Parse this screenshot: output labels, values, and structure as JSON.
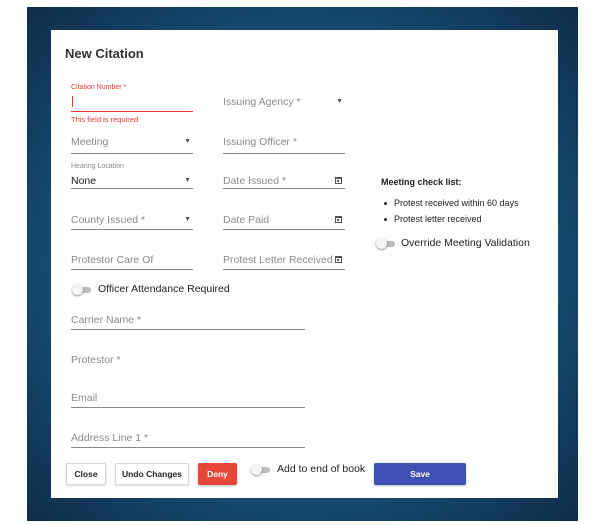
{
  "dialog": {
    "title": "New Citation"
  },
  "form": {
    "citation_number": {
      "label": "Citation Number *",
      "value": "",
      "error": "This field is required"
    },
    "issuing_agency": {
      "placeholder": "Issuing Agency *"
    },
    "meeting": {
      "placeholder": "Meeting"
    },
    "issuing_officer": {
      "placeholder": "Issuing Officer *"
    },
    "hearing_location": {
      "label": "Hearing Location",
      "value": "None"
    },
    "date_issued": {
      "placeholder": "Date Issued *"
    },
    "county_issued": {
      "placeholder": "County Issued *"
    },
    "date_paid": {
      "placeholder": "Date Paid"
    },
    "protestor_care_of": {
      "placeholder": "Protestor Care Of"
    },
    "protest_letter_received": {
      "placeholder": "Protest Letter Received"
    },
    "officer_attendance": {
      "label": "Officer Attendance Required",
      "checked": false
    },
    "carrier_name": {
      "placeholder": "Carrier Name *"
    },
    "protestor": {
      "placeholder": "Protestor *"
    },
    "email": {
      "placeholder": "Email"
    },
    "address_line_1": {
      "placeholder": "Address Line 1 *"
    }
  },
  "checklist": {
    "title": "Meeting check list:",
    "items": [
      "Protest received within 60 days",
      "Protest letter received"
    ],
    "override": {
      "label": "Override Meeting Validation",
      "checked": false
    }
  },
  "footer": {
    "close_label": "Close",
    "undo_label": "Undo Changes",
    "deny_label": "Deny",
    "add_to_end": {
      "label": "Add to end of book",
      "checked": false
    },
    "save_label": "Save"
  },
  "colors": {
    "error": "#e53935",
    "deny": "#e9463a",
    "save": "#3f51b5",
    "backdrop": "#1a5f85"
  },
  "icons": {
    "dropdown": "chevron-down-icon",
    "date": "calendar-icon",
    "toggle": "toggle-switch-icon"
  }
}
